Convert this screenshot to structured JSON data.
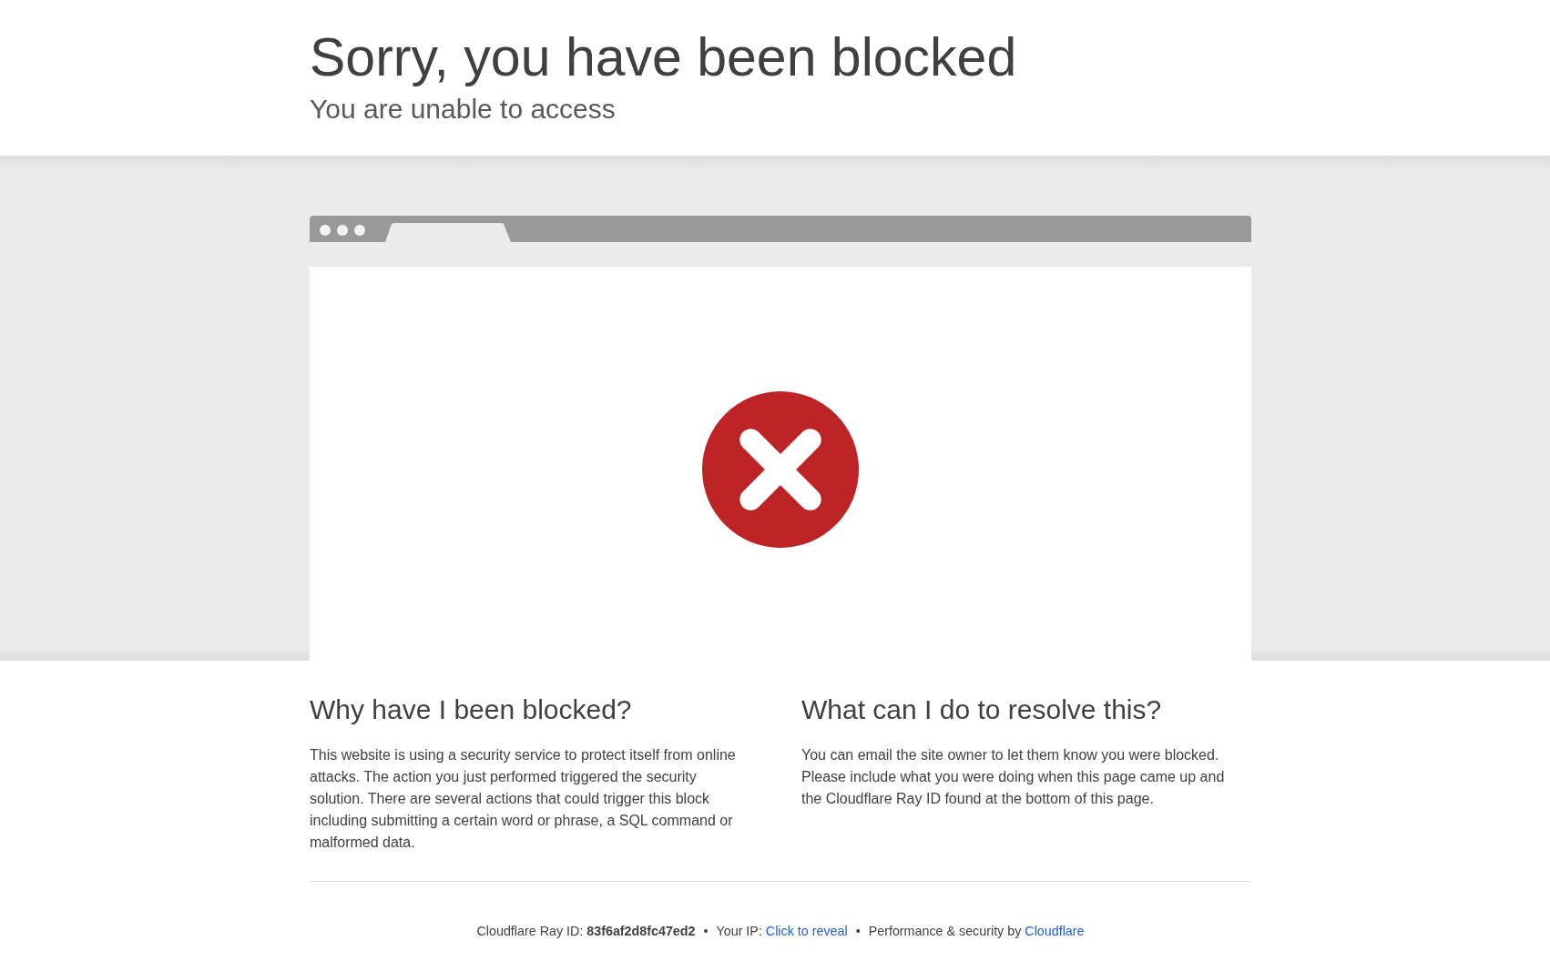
{
  "header": {
    "title": "Sorry, you have been blocked",
    "subtitle": "You are unable to access"
  },
  "sections": [
    {
      "heading": "Why have I been blocked?",
      "body": "This website is using a security service to protect itself from online attacks. The action you just performed triggered the security solution. There are several actions that could trigger this block including submitting a certain word or phrase, a SQL command or malformed data."
    },
    {
      "heading": "What can I do to resolve this?",
      "body": "You can email the site owner to let them know you were blocked. Please include what you were doing when this page came up and the Cloudflare Ray ID found at the bottom of this page."
    }
  ],
  "footer": {
    "items": [
      {
        "kind": "text",
        "text": "Cloudflare Ray ID: **83f6af2d8fc47ed2**"
      },
      {
        "kind": "separator",
        "text": "•"
      },
      {
        "kind": "text",
        "text": "Your IP:"
      },
      {
        "kind": "link",
        "text": "Click to reveal"
      },
      {
        "kind": "separator",
        "text": "•"
      },
      {
        "kind": "text",
        "text": "Performance & security by"
      },
      {
        "kind": "link",
        "text": "Cloudflare"
      }
    ]
  }
}
